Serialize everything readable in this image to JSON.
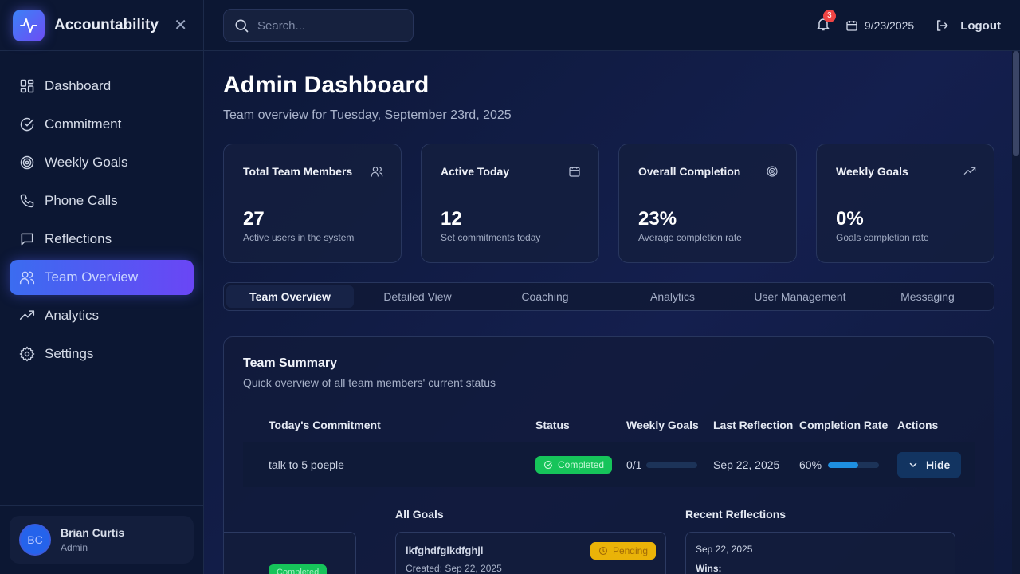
{
  "brand": {
    "name": "Accountability"
  },
  "sidebar": {
    "items": [
      {
        "label": "Dashboard"
      },
      {
        "label": "Commitment"
      },
      {
        "label": "Weekly Goals"
      },
      {
        "label": "Phone Calls"
      },
      {
        "label": "Reflections"
      },
      {
        "label": "Team Overview"
      },
      {
        "label": "Analytics"
      },
      {
        "label": "Settings"
      }
    ],
    "active_index": 5
  },
  "user": {
    "initials": "BC",
    "name": "Brian Curtis",
    "role": "Admin"
  },
  "topbar": {
    "search_placeholder": "Search...",
    "notification_count": "3",
    "date": "9/23/2025",
    "logout_label": "Logout"
  },
  "page": {
    "title": "Admin Dashboard",
    "subtitle": "Team overview for Tuesday, September 23rd, 2025"
  },
  "stats": [
    {
      "title": "Total Team Members",
      "value": "27",
      "desc": "Active users in the system",
      "icon": "users-icon"
    },
    {
      "title": "Active Today",
      "value": "12",
      "desc": "Set commitments today",
      "icon": "calendar-icon"
    },
    {
      "title": "Overall Completion",
      "value": "23%",
      "desc": "Average completion rate",
      "icon": "target-icon"
    },
    {
      "title": "Weekly Goals",
      "value": "0%",
      "desc": "Goals completion rate",
      "icon": "trending-up-icon"
    }
  ],
  "tabs": [
    {
      "label": "Team Overview"
    },
    {
      "label": "Detailed View"
    },
    {
      "label": "Coaching"
    },
    {
      "label": "Analytics"
    },
    {
      "label": "User Management"
    },
    {
      "label": "Messaging"
    }
  ],
  "summary": {
    "title": "Team Summary",
    "subtitle": "Quick overview of all team members' current status",
    "columns": {
      "commitment": "Today's Commitment",
      "status": "Status",
      "weekly_goals": "Weekly Goals",
      "last_reflection": "Last Reflection",
      "completion_rate": "Completion Rate",
      "actions": "Actions"
    },
    "row": {
      "commitment": "talk to 5 poeple",
      "status": "Completed",
      "weekly_goals": "0/1",
      "weekly_goals_progress": 0,
      "last_reflection": "Sep 22, 2025",
      "completion_rate": "60%",
      "completion_progress": 0.6,
      "action_label": "Hide"
    },
    "details": {
      "all_goals_title": "All Goals",
      "recent_reflections_title": "Recent Reflections",
      "first_card_status": "Completed",
      "goal": {
        "name": "lkfghdfglkdfghjl",
        "created": "Created: Sep 22, 2025",
        "status": "Pending"
      },
      "reflection": {
        "date": "Sep 22, 2025",
        "wins_label": "Wins:"
      }
    }
  },
  "colors": {
    "accent": "#4f5bf0",
    "success": "#16c45a",
    "warning": "#eab308",
    "progress": "#1e8fe0"
  }
}
